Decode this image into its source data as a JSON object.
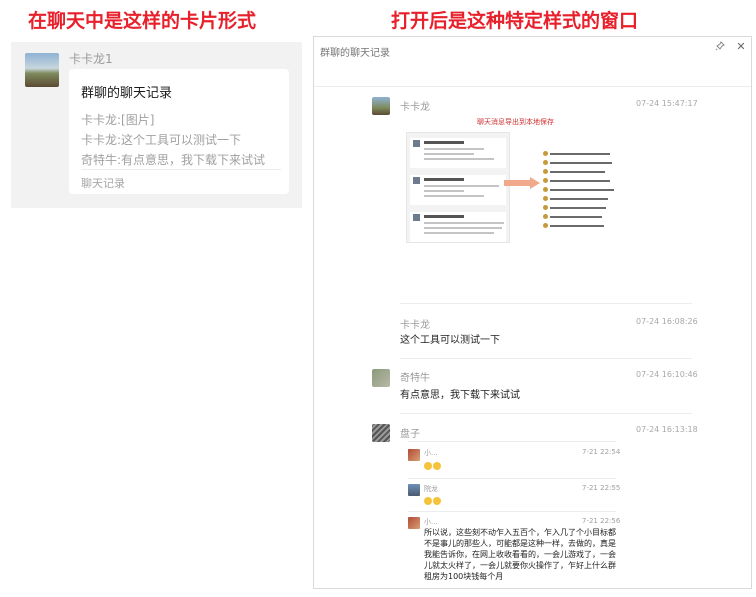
{
  "headings": {
    "left": "在聊天中是这样的卡片形式",
    "right": "打开后是这种特定样式的窗口"
  },
  "chat_card": {
    "sender": "卡卡龙1",
    "title": "群聊的聊天记录",
    "lines": [
      "卡卡龙:[图片]",
      "卡卡龙:这个工具可以测试一下",
      "奇特牛:有点意思，我下载下来试试"
    ],
    "footer": "聊天记录"
  },
  "window": {
    "title": "群聊的聊天记录",
    "pin_icon": "pin-icon",
    "close_icon": "close-icon",
    "messages": [
      {
        "name": "卡卡龙",
        "time": "07-24 15:47:17",
        "type": "image",
        "image_caption": "聊天消息导出到本地保存"
      },
      {
        "name": "卡卡龙",
        "time": "07-24 16:08:26",
        "text": "这个工具可以测试一下"
      },
      {
        "name": "奇特牛",
        "time": "07-24 16:10:46",
        "text": "有点意思，我下载下来试试"
      },
      {
        "name": "盘子",
        "time": "07-24 16:13:18",
        "type": "forwarded",
        "nested": [
          {
            "name": "小...",
            "time": "7-21 22:54",
            "text": ""
          },
          {
            "name": "院龙",
            "time": "7-21 22:55",
            "text": ""
          },
          {
            "name": "小...",
            "time": "7-21 22:56",
            "text": "所以说，这些刻不动乍入五百个，乍入几了个小目标都不是事儿的那些人，可能都是这种一样，去做的，真是我能告诉你，在网上收收看看的，一会儿游戏了，一会儿就太火样了，一会儿就要你火操作了，乍好上什么群租房为100块钱每个月"
          }
        ]
      }
    ]
  },
  "colors": {
    "heading_red": "#e8202b",
    "card_bg": "#f2f2f2",
    "muted_text": "#9a9a9a"
  }
}
